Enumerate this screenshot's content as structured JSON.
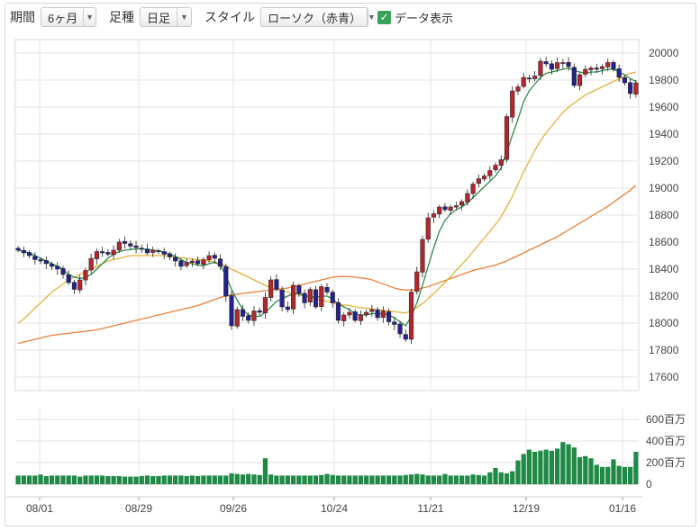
{
  "toolbar": {
    "period_label": "期間",
    "period_value": "6ヶ月",
    "candle_label": "足種",
    "candle_value": "日足",
    "style_label": "スタイル",
    "style_value": "ローソク（赤青）",
    "data_display_label": "データ表示",
    "data_display_checked": true
  },
  "colors": {
    "up": "#b0272d",
    "down": "#24228a",
    "ma_short": "#2f8c4e",
    "ma_mid": "#e3b23c",
    "ma_long": "#e8803a",
    "volume": "#1f8a45",
    "grid": "#e3e3e3"
  },
  "chart_data": [
    {
      "type": "candlestick",
      "title": "",
      "x_tick_labels": [
        "08/01",
        "08/29",
        "09/26",
        "10/24",
        "11/21",
        "12/19",
        "01/16"
      ],
      "y_tick_labels": [
        "20000",
        "19800",
        "19600",
        "19400",
        "19200",
        "19000",
        "18800",
        "18600",
        "18400",
        "18200",
        "18000",
        "17800",
        "17600"
      ],
      "ylim": [
        17500,
        20100
      ],
      "grid": true,
      "series": [
        {
          "kind": "ohlc",
          "close": [
            18540,
            18520,
            18500,
            18470,
            18460,
            18440,
            18420,
            18400,
            18360,
            18300,
            18250,
            18320,
            18390,
            18480,
            18530,
            18520,
            18510,
            18540,
            18600,
            18590,
            18570,
            18560,
            18550,
            18520,
            18540,
            18530,
            18510,
            18490,
            18460,
            18420,
            18450,
            18460,
            18440,
            18470,
            18500,
            18480,
            18420,
            18200,
            17980,
            18100,
            18050,
            18020,
            18090,
            18080,
            18190,
            18320,
            18250,
            18120,
            18100,
            18280,
            18220,
            18150,
            18250,
            18120,
            18270,
            18230,
            18150,
            18020,
            18060,
            18080,
            18020,
            18060,
            18080,
            18100,
            18040,
            18090,
            18010,
            17990,
            17920,
            17880,
            18230,
            18380,
            18620,
            18780,
            18810,
            18860,
            18840,
            18860,
            18870,
            18900,
            18960,
            19030,
            19070,
            19090,
            19130,
            19170,
            19210,
            19530,
            19720,
            19750,
            19820,
            19810,
            19830,
            19940,
            19920,
            19880,
            19930,
            19930,
            19900,
            19760,
            19840,
            19880,
            19890,
            19880,
            19900,
            19930,
            19880,
            19820,
            19780,
            19700,
            19780
          ]
        },
        {
          "kind": "moving_average",
          "name": "",
          "values": [
            18540,
            18530,
            18520,
            18500,
            18480,
            18460,
            18440,
            18420,
            18400,
            18360,
            18340,
            18330,
            18340,
            18360,
            18400,
            18440,
            18480,
            18510,
            18530,
            18540,
            18545,
            18550,
            18550,
            18545,
            18540,
            18535,
            18525,
            18510,
            18495,
            18470,
            18450,
            18440,
            18430,
            18425,
            18440,
            18450,
            18430,
            18350,
            18250,
            18170,
            18100,
            18060,
            18050,
            18050,
            18080,
            18120,
            18160,
            18180,
            18200,
            18220,
            18220,
            18200,
            18200,
            18190,
            18200,
            18200,
            18180,
            18140,
            18120,
            18100,
            18070,
            18060,
            18060,
            18070,
            18070,
            18070,
            18060,
            18040,
            18010,
            17980,
            18050,
            18150,
            18280,
            18420,
            18560,
            18680,
            18760,
            18810,
            18840,
            18860,
            18890,
            18930,
            18970,
            19010,
            19050,
            19090,
            19150,
            19270,
            19390,
            19510,
            19640,
            19720,
            19770,
            19820,
            19850,
            19860,
            19870,
            19880,
            19890,
            19870,
            19860,
            19850,
            19860,
            19860,
            19870,
            19880,
            19880,
            19860,
            19840,
            19810,
            19790
          ]
        },
        {
          "kind": "moving_average",
          "name": "",
          "values": [
            18000,
            18030,
            18070,
            18110,
            18150,
            18190,
            18230,
            18260,
            18290,
            18320,
            18340,
            18360,
            18380,
            18400,
            18420,
            18440,
            18460,
            18470,
            18480,
            18490,
            18500,
            18500,
            18500,
            18500,
            18500,
            18500,
            18500,
            18495,
            18490,
            18485,
            18480,
            18475,
            18470,
            18465,
            18460,
            18455,
            18440,
            18420,
            18400,
            18380,
            18360,
            18340,
            18320,
            18300,
            18280,
            18260,
            18250,
            18240,
            18230,
            18220,
            18210,
            18200,
            18190,
            18180,
            18170,
            18160,
            18150,
            18140,
            18135,
            18130,
            18120,
            18115,
            18110,
            18105,
            18100,
            18095,
            18090,
            18085,
            18080,
            18075,
            18095,
            18115,
            18145,
            18180,
            18220,
            18260,
            18300,
            18345,
            18390,
            18435,
            18480,
            18530,
            18580,
            18630,
            18680,
            18730,
            18790,
            18860,
            18940,
            19030,
            19120,
            19200,
            19280,
            19350,
            19410,
            19460,
            19510,
            19560,
            19600,
            19630,
            19660,
            19690,
            19710,
            19730,
            19750,
            19770,
            19790,
            19810,
            19830,
            19850,
            19860
          ]
        },
        {
          "kind": "moving_average",
          "name": "",
          "values": [
            17850,
            17860,
            17870,
            17880,
            17890,
            17900,
            17910,
            17915,
            17920,
            17925,
            17930,
            17935,
            17940,
            17945,
            17950,
            17960,
            17970,
            17980,
            17990,
            18000,
            18010,
            18020,
            18030,
            18040,
            18050,
            18060,
            18070,
            18080,
            18090,
            18100,
            18110,
            18120,
            18130,
            18145,
            18160,
            18175,
            18190,
            18200,
            18210,
            18215,
            18220,
            18225,
            18230,
            18235,
            18240,
            18245,
            18250,
            18255,
            18260,
            18270,
            18280,
            18290,
            18300,
            18310,
            18320,
            18330,
            18340,
            18345,
            18345,
            18345,
            18340,
            18335,
            18330,
            18320,
            18305,
            18290,
            18275,
            18260,
            18250,
            18245,
            18245,
            18250,
            18260,
            18270,
            18285,
            18300,
            18315,
            18330,
            18345,
            18360,
            18375,
            18390,
            18400,
            18410,
            18420,
            18430,
            18445,
            18460,
            18480,
            18500,
            18520,
            18540,
            18560,
            18580,
            18600,
            18620,
            18640,
            18665,
            18690,
            18715,
            18740,
            18765,
            18790,
            18815,
            18840,
            18865,
            18895,
            18925,
            18955,
            18985,
            19020
          ]
        }
      ]
    },
    {
      "type": "bar",
      "title": "",
      "y_tick_labels": [
        "600百万",
        "400百万",
        "200百万",
        "0"
      ],
      "ylim": [
        0,
        700
      ],
      "values": [
        80,
        80,
        80,
        80,
        90,
        75,
        80,
        80,
        80,
        80,
        80,
        70,
        80,
        80,
        80,
        80,
        75,
        75,
        75,
        70,
        70,
        70,
        75,
        80,
        75,
        75,
        80,
        80,
        80,
        80,
        75,
        80,
        75,
        80,
        80,
        80,
        80,
        80,
        100,
        95,
        90,
        95,
        90,
        85,
        240,
        90,
        80,
        80,
        80,
        80,
        80,
        80,
        80,
        80,
        85,
        95,
        85,
        80,
        80,
        80,
        80,
        80,
        80,
        80,
        80,
        80,
        80,
        80,
        80,
        85,
        90,
        95,
        90,
        80,
        80,
        80,
        95,
        80,
        80,
        80,
        80,
        90,
        85,
        80,
        110,
        150,
        110,
        100,
        120,
        220,
        280,
        320,
        300,
        310,
        320,
        310,
        330,
        390,
        370,
        340,
        250,
        260,
        240,
        180,
        160,
        160,
        230,
        170,
        160,
        160,
        300
      ]
    }
  ]
}
